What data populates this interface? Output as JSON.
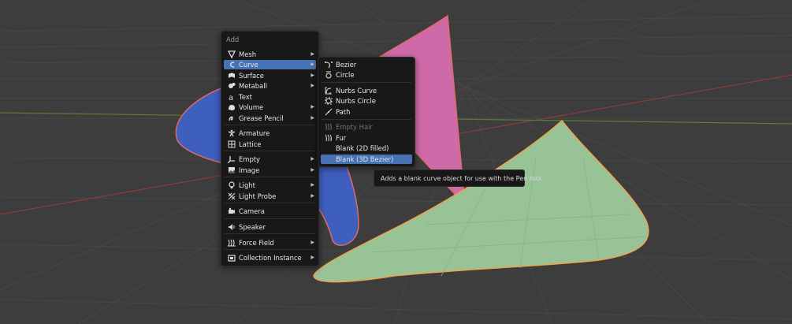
{
  "add_menu": {
    "title": "Add",
    "items": [
      {
        "label": "Mesh",
        "icon": "mesh-icon",
        "submenu": true
      },
      {
        "label": "Curve",
        "icon": "curve-icon",
        "submenu": true,
        "active": true
      },
      {
        "label": "Surface",
        "icon": "surface-icon",
        "submenu": true
      },
      {
        "label": "Metaball",
        "icon": "metaball-icon",
        "submenu": true
      },
      {
        "label": "Text",
        "icon": "text-icon",
        "submenu": false
      },
      {
        "label": "Volume",
        "icon": "volume-icon",
        "submenu": true
      },
      {
        "label": "Grease Pencil",
        "icon": "grease-pencil-icon",
        "submenu": true
      },
      {
        "label": "Armature",
        "icon": "armature-icon",
        "submenu": false
      },
      {
        "label": "Lattice",
        "icon": "lattice-icon",
        "submenu": false
      },
      {
        "label": "Empty",
        "icon": "empty-icon",
        "submenu": true
      },
      {
        "label": "Image",
        "icon": "image-icon",
        "submenu": true
      },
      {
        "label": "Light",
        "icon": "light-icon",
        "submenu": true
      },
      {
        "label": "Light Probe",
        "icon": "light-probe-icon",
        "submenu": true
      },
      {
        "label": "Camera",
        "icon": "camera-icon",
        "submenu": false
      },
      {
        "label": "Speaker",
        "icon": "speaker-icon",
        "submenu": false
      },
      {
        "label": "Force Field",
        "icon": "force-field-icon",
        "submenu": true
      },
      {
        "label": "Collection Instance",
        "icon": "collection-icon",
        "submenu": true
      }
    ],
    "submenu_arrow": "▶"
  },
  "curve_submenu": {
    "items": [
      {
        "label": "Bezier",
        "icon": "bezier-icon"
      },
      {
        "label": "Circle",
        "icon": "bezier-circle-icon"
      },
      {
        "label": "Nurbs Curve",
        "icon": "nurbs-curve-icon"
      },
      {
        "label": "Nurbs Circle",
        "icon": "nurbs-circle-icon"
      },
      {
        "label": "Path",
        "icon": "path-icon"
      },
      {
        "label": "Empty Hair",
        "icon": "empty-hair-icon",
        "disabled": true
      },
      {
        "label": "Fur",
        "icon": "fur-icon"
      },
      {
        "label": "Blank (2D filled)",
        "icon": ""
      },
      {
        "label": "Blank (3D Bezier)",
        "icon": "",
        "active": true
      }
    ]
  },
  "tooltip": {
    "text": "Adds a blank curve object for use with the Pen tool."
  },
  "colors": {
    "background": "#3d3d3d",
    "menu_bg": "#181818",
    "highlight": "#4772b3",
    "blue_shape": "#3f5fbf",
    "pink_shape": "#cf6aa8",
    "green_shape": "#97c397",
    "x_axis": "#8f3a3a",
    "y_axis": "#5a7a3a"
  }
}
